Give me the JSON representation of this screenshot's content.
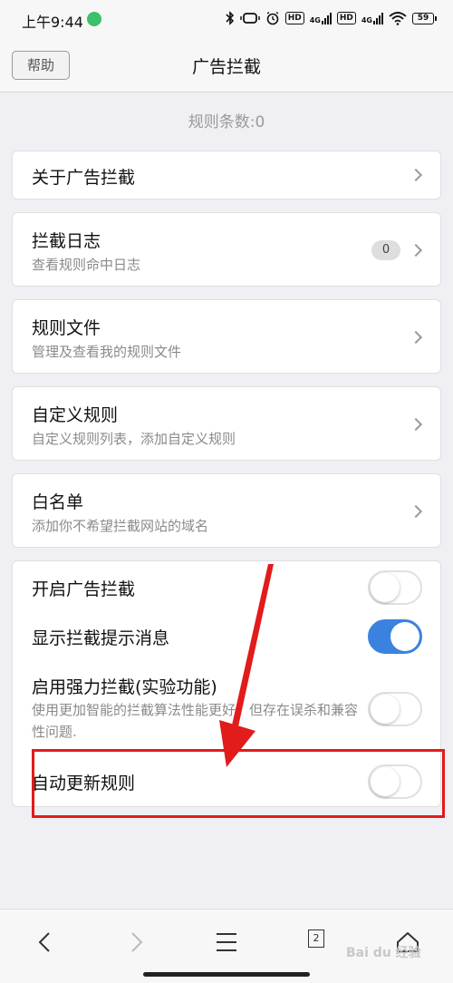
{
  "status_bar": {
    "time": "上午9:44",
    "network_1": "4G",
    "hd_1": "HD",
    "network_2": "4G",
    "hd_2": "HD",
    "battery": "59",
    "icons": [
      "bluetooth-icon",
      "vibrate-icon",
      "alarm-icon",
      "wifi-icon"
    ]
  },
  "header": {
    "help_label": "帮助",
    "title": "广告拦截"
  },
  "rule_count": "规则条数:0",
  "menu": {
    "about": {
      "title": "关于广告拦截"
    },
    "log": {
      "title": "拦截日志",
      "subtitle": "查看规则命中日志",
      "badge": "0"
    },
    "rule_files": {
      "title": "规则文件",
      "subtitle": "管理及查看我的规则文件"
    },
    "custom_rules": {
      "title": "自定义规则",
      "subtitle": "自定义规则列表，添加自定义规则"
    },
    "whitelist": {
      "title": "白名单",
      "subtitle": "添加你不希望拦截网站的域名"
    }
  },
  "settings": {
    "enable_adblock": {
      "label": "开启广告拦截",
      "on": false
    },
    "show_tips": {
      "label": "显示拦截提示消息",
      "on": true
    },
    "strong_block": {
      "label": "启用强力拦截(实验功能)",
      "desc": "使用更加智能的拦截算法性能更好，但存在误杀和兼容性问题.",
      "on": false
    },
    "auto_update": {
      "label": "自动更新规则",
      "on": false
    }
  },
  "bottom_bar": {
    "tab_count": "2",
    "icons": [
      "back-icon",
      "forward-icon",
      "menu-icon",
      "tabs-icon",
      "home-icon"
    ]
  },
  "watermark": "Bai du 经验",
  "colors": {
    "accent": "#3b82e0",
    "annotation": "#e21b1b"
  }
}
